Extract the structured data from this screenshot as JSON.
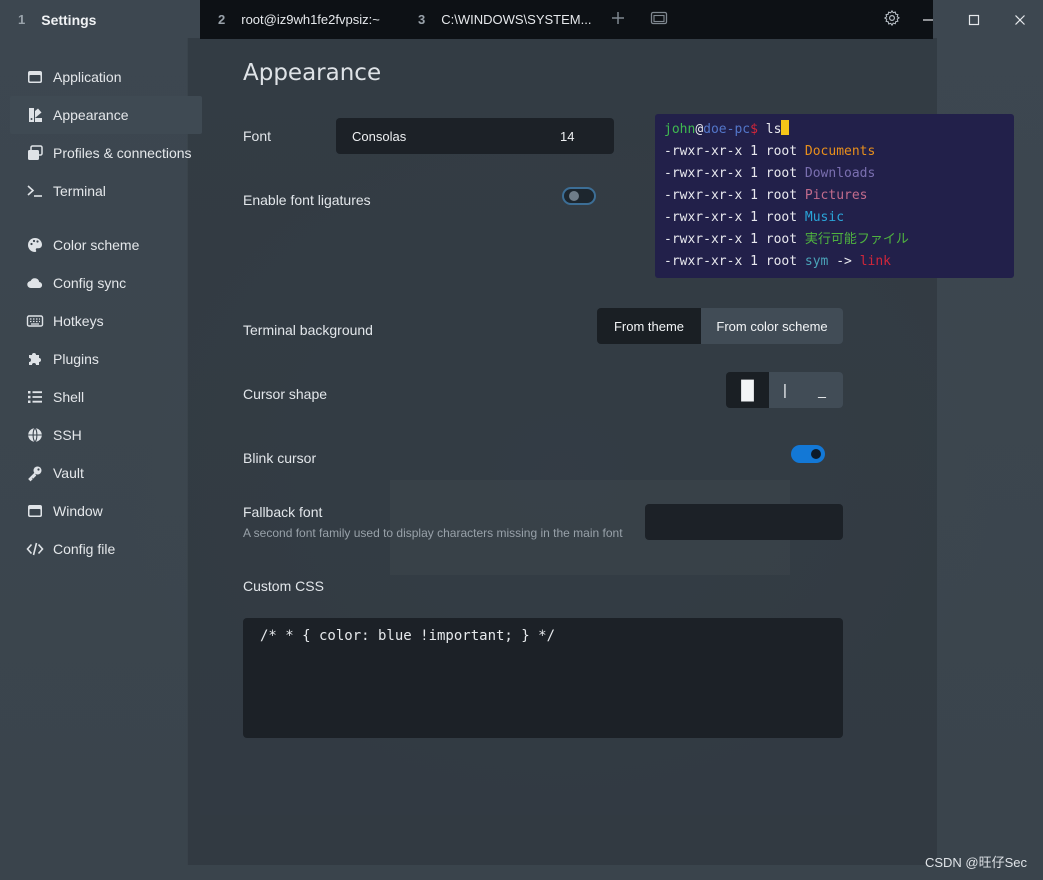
{
  "titlebar": {
    "tabs": [
      {
        "num": "1",
        "label": "Settings"
      },
      {
        "num": "2",
        "label": "root@iz9wh1fe2fvpsiz:~"
      },
      {
        "num": "3",
        "label": "C:\\WINDOWS\\SYSTEM..."
      }
    ],
    "icons": [
      "plus-icon",
      "window-icon",
      "gear-icon",
      "minimize-icon",
      "maximize-icon",
      "close-icon"
    ]
  },
  "sidebar": {
    "items": [
      {
        "label": "Application",
        "icon": "window-icon"
      },
      {
        "label": "Appearance",
        "icon": "paint-icon",
        "active": true
      },
      {
        "label": "Profiles & connections",
        "icon": "windows-stack-icon"
      },
      {
        "label": "Terminal",
        "icon": "terminal-icon"
      },
      {
        "label": "Color scheme",
        "icon": "palette-icon"
      },
      {
        "label": "Config sync",
        "icon": "cloud-icon"
      },
      {
        "label": "Hotkeys",
        "icon": "keyboard-icon"
      },
      {
        "label": "Plugins",
        "icon": "puzzle-icon"
      },
      {
        "label": "Shell",
        "icon": "list-icon"
      },
      {
        "label": "SSH",
        "icon": "globe-icon"
      },
      {
        "label": "Vault",
        "icon": "key-icon"
      },
      {
        "label": "Window",
        "icon": "window-icon"
      },
      {
        "label": "Config file",
        "icon": "code-icon"
      }
    ]
  },
  "main": {
    "title": "Appearance",
    "font": {
      "label": "Font",
      "name": "Consolas",
      "size": "14"
    },
    "ligatures": {
      "label": "Enable font ligatures",
      "enabled": false
    },
    "preview": {
      "prompt_user": "john",
      "prompt_at": "@",
      "prompt_host": "doe-pc",
      "prompt_symbol": "$ ",
      "command": "ls",
      "rows": [
        {
          "perms": "-rwxr-xr-x 1 root ",
          "name": "Documents",
          "color": "#e88f1c"
        },
        {
          "perms": "-rwxr-xr-x 1 root ",
          "name": "Downloads",
          "color": "#7a6fb0"
        },
        {
          "perms": "-rwxr-xr-x 1 root ",
          "name": "Pictures",
          "color": "#c16b8c"
        },
        {
          "perms": "-rwxr-xr-x 1 root ",
          "name": "Music",
          "color": "#2aa4d8"
        },
        {
          "perms": "-rwxr-xr-x 1 root ",
          "name": "実行可能ファイル",
          "color": "#4fb33f"
        }
      ],
      "symlink": {
        "perms": "-rwxr-xr-x 1 root ",
        "name": "sym",
        "arrow": " -> ",
        "target": "link"
      }
    },
    "terminal_background": {
      "label": "Terminal background",
      "options": [
        "From theme",
        "From color scheme"
      ],
      "selected": "From color scheme"
    },
    "cursor_shape": {
      "label": "Cursor shape",
      "options": [
        "█",
        "|",
        "_"
      ],
      "selected": "█"
    },
    "blink_cursor": {
      "label": "Blink cursor",
      "enabled": true
    },
    "fallback_font": {
      "label": "Fallback font",
      "description": "A second font family used to display characters missing in the main font",
      "value": ""
    },
    "custom_css": {
      "label": "Custom CSS",
      "value": "/* * { color: blue !important; } */"
    }
  },
  "watermark": "CSDN @旺仔Sec"
}
